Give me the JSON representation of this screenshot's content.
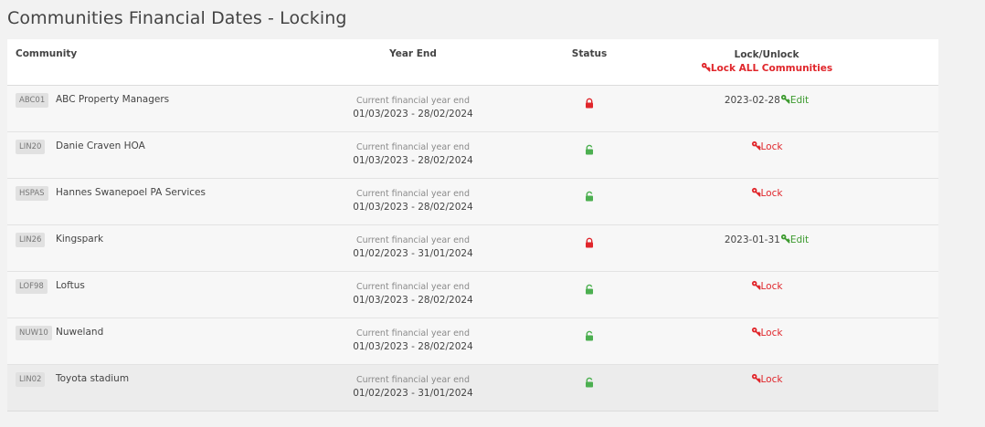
{
  "title": "Communities Financial Dates - Locking",
  "columns": {
    "community": "Community",
    "year_end": "Year End",
    "status": "Status",
    "lock_unlock": "Lock/Unlock",
    "lock_all": "Lock ALL Communities"
  },
  "colors": {
    "locked": "#e0262b",
    "unlocked": "#4caf50",
    "edit": "#3c9a2e"
  },
  "rows": [
    {
      "code": "ABC01",
      "name": "ABC Property Managers",
      "year_label": "Current financial year end",
      "range": "01/03/2023 - 28/02/2024",
      "status": "locked",
      "locked_date": "2023-02-28",
      "action": "Edit"
    },
    {
      "code": "LIN20",
      "name": "Danie Craven HOA",
      "year_label": "Current financial year end",
      "range": "01/03/2023 - 28/02/2024",
      "status": "unlocked",
      "locked_date": "",
      "action": "Lock"
    },
    {
      "code": "HSPAS",
      "name": "Hannes Swanepoel PA Services",
      "year_label": "Current financial year end",
      "range": "01/03/2023 - 28/02/2024",
      "status": "unlocked",
      "locked_date": "",
      "action": "Lock"
    },
    {
      "code": "LIN26",
      "name": "Kingspark",
      "year_label": "Current financial year end",
      "range": "01/02/2023 - 31/01/2024",
      "status": "locked",
      "locked_date": "2023-01-31",
      "action": "Edit"
    },
    {
      "code": "LOF98",
      "name": "Loftus",
      "year_label": "Current financial year end",
      "range": "01/03/2023 - 28/02/2024",
      "status": "unlocked",
      "locked_date": "",
      "action": "Lock"
    },
    {
      "code": "NUW10",
      "name": "Nuweland",
      "year_label": "Current financial year end",
      "range": "01/03/2023 - 28/02/2024",
      "status": "unlocked",
      "locked_date": "",
      "action": "Lock"
    },
    {
      "code": "LIN02",
      "name": "Toyota stadium",
      "year_label": "Current financial year end",
      "range": "01/02/2023 - 31/01/2024",
      "status": "unlocked",
      "locked_date": "",
      "action": "Lock"
    }
  ]
}
